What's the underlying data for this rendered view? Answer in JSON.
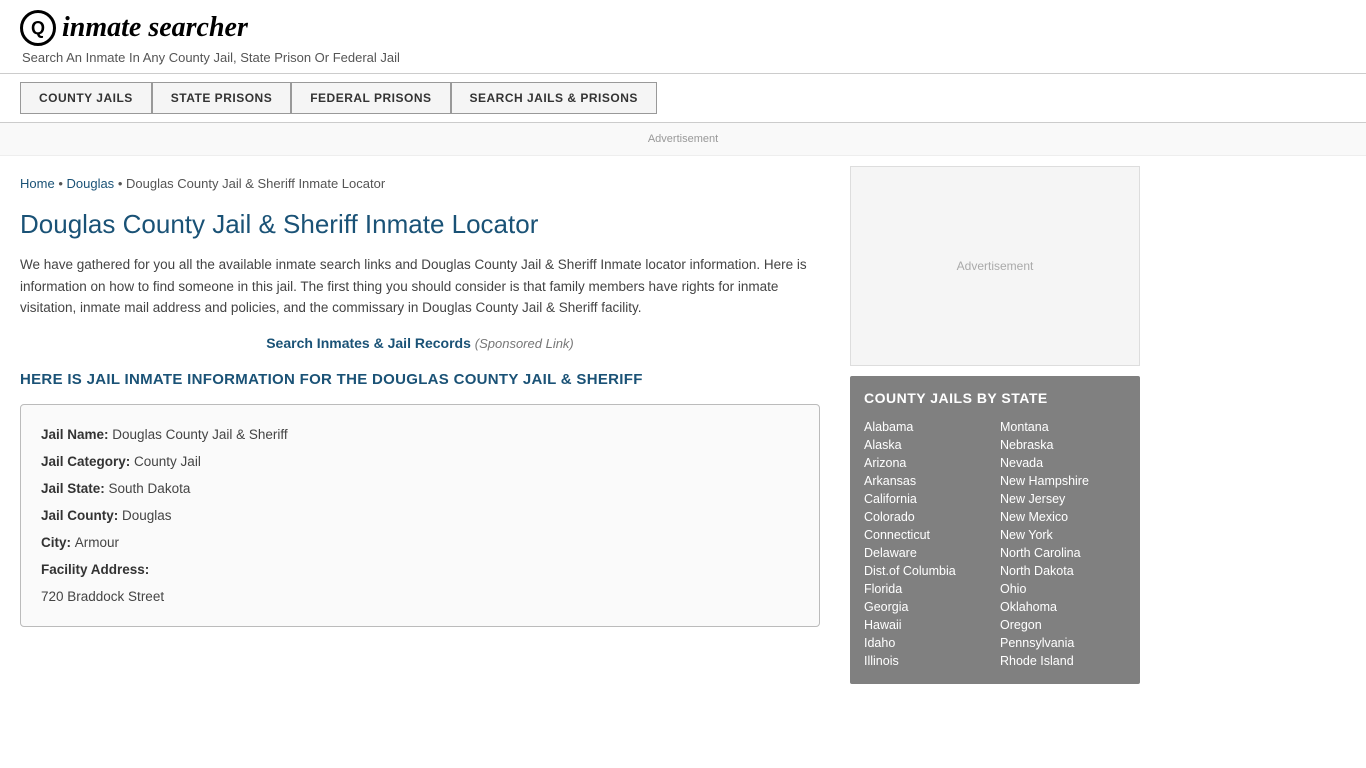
{
  "header": {
    "logo_icon": "🔍",
    "logo_text": "inmate searcher",
    "tagline": "Search An Inmate In Any County Jail, State Prison Or Federal Jail"
  },
  "nav": {
    "items": [
      {
        "label": "COUNTY JAILS",
        "id": "county-jails"
      },
      {
        "label": "STATE PRISONS",
        "id": "state-prisons"
      },
      {
        "label": "FEDERAL PRISONS",
        "id": "federal-prisons"
      },
      {
        "label": "SEARCH JAILS & PRISONS",
        "id": "search-jails-prisons"
      }
    ]
  },
  "ad_top": "Advertisement",
  "breadcrumb": {
    "home": "Home",
    "separator": "•",
    "parent": "Douglas",
    "current": "Douglas County Jail & Sheriff Inmate Locator"
  },
  "page": {
    "title": "Douglas County Jail & Sheriff Inmate Locator",
    "description": "We have gathered for you all the available inmate search links and Douglas County Jail & Sheriff Inmate locator information. Here is information on how to find someone in this jail. The first thing you should consider is that family members have rights for inmate visitation, inmate mail address and policies, and the commissary in Douglas County Jail & Sheriff facility.",
    "sponsored_link_text": "Search Inmates & Jail Records",
    "sponsored_link_suffix": "(Sponsored Link)",
    "section_heading": "HERE IS JAIL INMATE INFORMATION FOR THE DOUGLAS COUNTY JAIL & SHERIFF"
  },
  "info_box": {
    "fields": [
      {
        "label": "Jail Name:",
        "value": "Douglas County Jail & Sheriff"
      },
      {
        "label": "Jail Category:",
        "value": "County Jail"
      },
      {
        "label": "Jail State:",
        "value": "South Dakota"
      },
      {
        "label": "Jail County:",
        "value": "Douglas"
      },
      {
        "label": "City:",
        "value": "Armour"
      },
      {
        "label": "Facility Address:",
        "value": ""
      },
      {
        "label": "",
        "value": "720 Braddock Street"
      }
    ]
  },
  "sidebar": {
    "ad_label": "Advertisement",
    "county_jails_title": "COUNTY JAILS BY STATE",
    "states_col1": [
      "Alabama",
      "Alaska",
      "Arizona",
      "Arkansas",
      "California",
      "Colorado",
      "Connecticut",
      "Delaware",
      "Dist.of Columbia",
      "Florida",
      "Georgia",
      "Hawaii",
      "Idaho",
      "Illinois"
    ],
    "states_col2": [
      "Montana",
      "Nebraska",
      "Nevada",
      "New Hampshire",
      "New Jersey",
      "New Mexico",
      "New York",
      "North Carolina",
      "North Dakota",
      "Ohio",
      "Oklahoma",
      "Oregon",
      "Pennsylvania",
      "Rhode Island"
    ]
  }
}
